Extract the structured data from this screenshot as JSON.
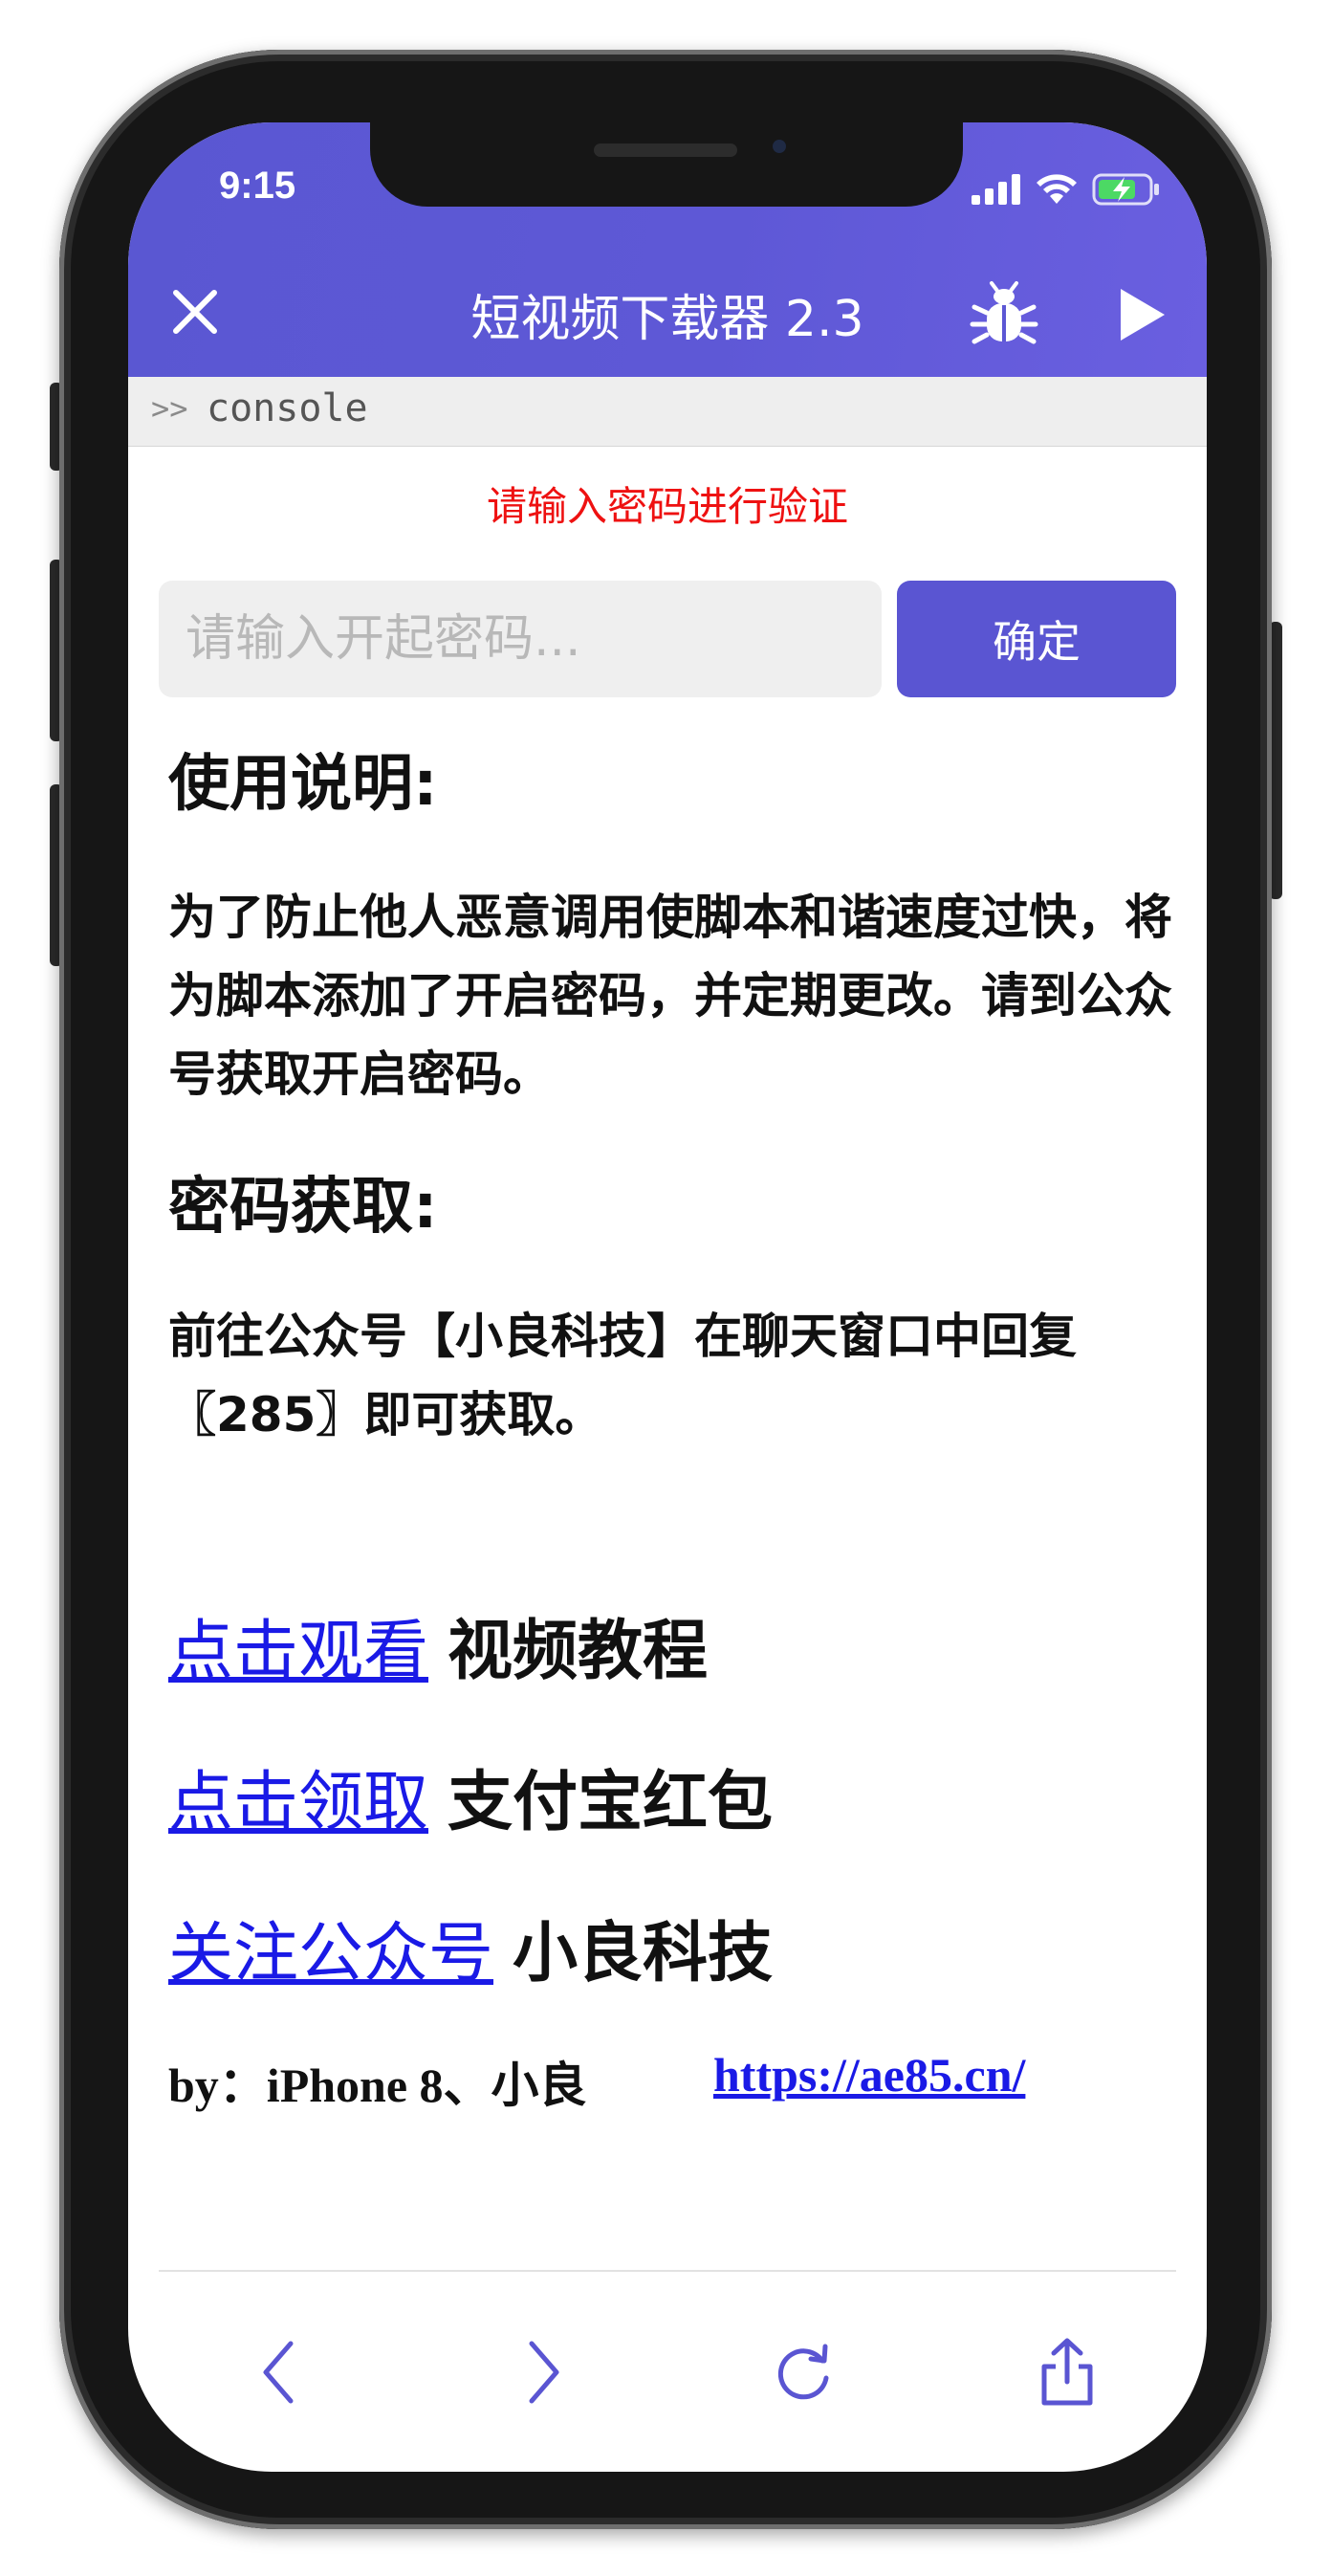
{
  "status_bar": {
    "time": "9:15",
    "icons": [
      "signal-icon",
      "wifi-icon",
      "battery-charging-icon"
    ]
  },
  "nav": {
    "title": "短视频下载器 2.3",
    "close_icon": "close-icon",
    "bug_icon": "bug-icon",
    "play_icon": "play-icon"
  },
  "console": {
    "prompt": ">>",
    "label": "console"
  },
  "verify": {
    "message": "请输入密码进行验证",
    "input_placeholder": "请输入开起密码...",
    "input_value": "",
    "confirm_label": "确定"
  },
  "usage": {
    "heading": "使用说明:",
    "text": "为了防止他人恶意调用使脚本和谐速度过快，将为脚本添加了开启密码，并定期更改。请到公众号获取开启密码。"
  },
  "password": {
    "heading": "密码获取:",
    "text": "前往公众号【小良科技】在聊天窗口中回复〖285〗即可获取。"
  },
  "links": [
    {
      "link_text": "点击观看",
      "tail": "视频教程"
    },
    {
      "link_text": "点击领取",
      "tail": "支付宝红包"
    },
    {
      "link_text": "关注公众号",
      "tail": "小良科技"
    }
  ],
  "footer": {
    "by": "by：iPhone 8、小良",
    "url": "https://ae85.cn/"
  },
  "toolbar": {
    "icons": [
      "back-icon",
      "forward-icon",
      "reload-icon",
      "share-icon"
    ]
  },
  "colors": {
    "accent": "#5a55d2",
    "error": "#ee1111",
    "link": "#1a1ae6"
  }
}
